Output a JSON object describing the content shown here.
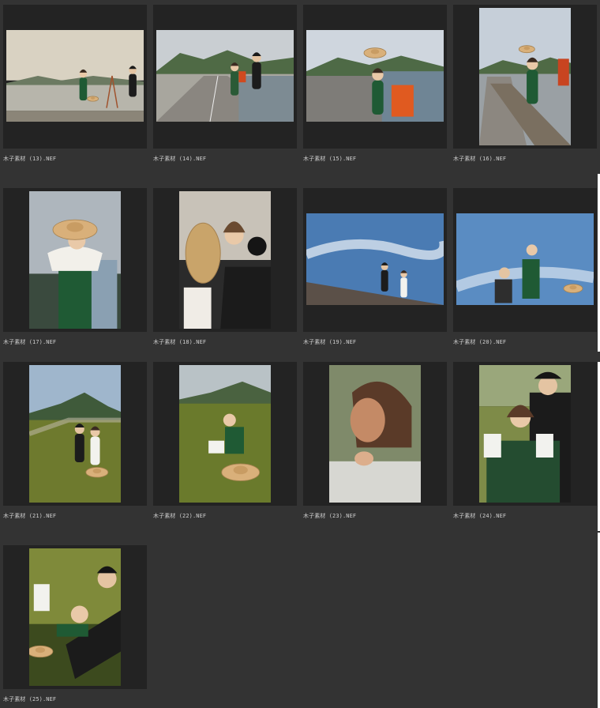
{
  "browser": {
    "thumbnails": [
      {
        "filename": "木子素材 (13).NEF",
        "orientation": "landscape",
        "scene": "lake-pier-couple",
        "colors": {
          "sky": "#d9d2c2",
          "ground": "#8b8578",
          "accent": "#1f5a34"
        }
      },
      {
        "filename": "木子素材 (14).NEF",
        "orientation": "landscape",
        "scene": "road-couple-easel",
        "colors": {
          "sky": "#c9ced2",
          "ground": "#8a8680",
          "accent": "#d04a1f"
        }
      },
      {
        "filename": "木子素材 (15).NEF",
        "orientation": "landscape",
        "scene": "road-hat-easel",
        "colors": {
          "sky": "#cfd6de",
          "ground": "#7e7c78",
          "accent": "#e05a20"
        }
      },
      {
        "filename": "木子素材 (16).NEF",
        "orientation": "portrait",
        "scene": "jumping-hat",
        "colors": {
          "sky": "#c6cfd9",
          "ground": "#8c8780",
          "accent": "#c84420"
        }
      },
      {
        "filename": "木子素材 (17).NEF",
        "orientation": "portrait",
        "scene": "hat-closeup",
        "colors": {
          "sky": "#aeb6bd",
          "ground": "#3a4a3e",
          "accent": "#1f5a34"
        }
      },
      {
        "filename": "木子素材 (18).NEF",
        "orientation": "portrait",
        "scene": "couple-hat-closeup",
        "colors": {
          "sky": "#c8c2b8",
          "ground": "#2b2b2b",
          "accent": "#c9a46a"
        }
      },
      {
        "filename": "木子素材 (19).NEF",
        "orientation": "landscape",
        "scene": "blue-sky-couple",
        "colors": {
          "sky": "#4a7bb3",
          "ground": "#5b5048",
          "accent": "#e8eef5"
        }
      },
      {
        "filename": "木子素材 (20).NEF",
        "orientation": "landscape",
        "scene": "blue-sky-lowangle",
        "colors": {
          "sky": "#5a8cc2",
          "ground": "#2e2e2e",
          "accent": "#1f5a34"
        }
      },
      {
        "filename": "木子素材 (21).NEF",
        "orientation": "portrait",
        "scene": "hill-couple",
        "colors": {
          "sky": "#9fb6cc",
          "ground": "#6e7a2e",
          "accent": "#e9dcc4"
        }
      },
      {
        "filename": "木子素材 (22).NEF",
        "orientation": "portrait",
        "scene": "hill-sitting",
        "colors": {
          "sky": "#b9c2c6",
          "ground": "#6a7a2c",
          "accent": "#e3c48a"
        }
      },
      {
        "filename": "木子素材 (23).NEF",
        "orientation": "portrait",
        "scene": "portrait-face",
        "colors": {
          "sky": "#7f8a6a",
          "ground": "#d7d7d2",
          "accent": "#c48a66"
        }
      },
      {
        "filename": "木子素材 (24).NEF",
        "orientation": "portrait",
        "scene": "couple-embrace",
        "colors": {
          "sky": "#9aa77b",
          "ground": "#244c30",
          "accent": "#f2f2ee"
        }
      },
      {
        "filename": "木子素材 (25).NEF",
        "orientation": "portrait",
        "scene": "lying-grass",
        "colors": {
          "sky": "#7f8a3a",
          "ground": "#3c4a1e",
          "accent": "#e2c58a"
        }
      }
    ]
  }
}
